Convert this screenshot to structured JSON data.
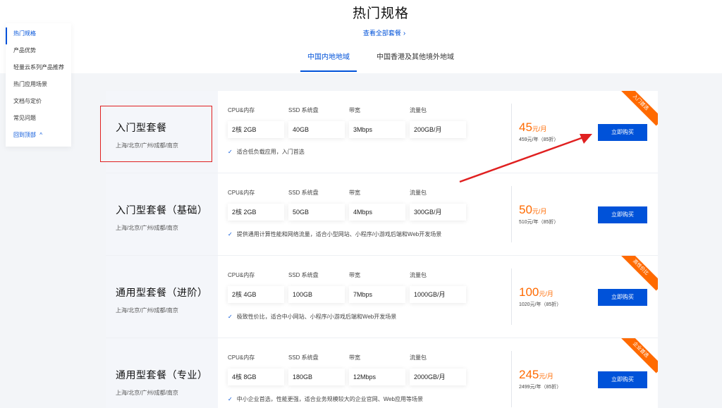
{
  "header": {
    "title": "热门规格",
    "view_all": "查看全部套餐",
    "tabs": [
      {
        "label": "中国内地地域",
        "active": true
      },
      {
        "label": "中国香港及其他境外地域",
        "active": false
      }
    ]
  },
  "sidebar": {
    "items": [
      {
        "label": "热门规格",
        "active": true
      },
      {
        "label": "产品优势"
      },
      {
        "label": "轻量云系列产品推荐"
      },
      {
        "label": "热门应用场景"
      },
      {
        "label": "文档与定价"
      },
      {
        "label": "常见问题"
      },
      {
        "label": "回到顶部"
      }
    ]
  },
  "spec_labels": [
    "CPU&内存",
    "SSD 系统盘",
    "带宽",
    "流量包"
  ],
  "buy_label": "立即购买",
  "plans": [
    {
      "name": "入门型套餐",
      "regions": "上海/北京/广州/成都/南京",
      "specs": [
        "2核 2GB",
        "40GB",
        "3Mbps",
        "200GB/月"
      ],
      "desc": "适合低负载应用，入门首选",
      "price": "45",
      "price_unit": "元/月",
      "yearly": "459元/年（85折）",
      "ribbon": "入门首选"
    },
    {
      "name": "入门型套餐（基础）",
      "regions": "上海/北京/广州/成都/南京",
      "specs": [
        "2核 2GB",
        "50GB",
        "4Mbps",
        "300GB/月"
      ],
      "desc": "提供通用计算性能和网络流量，适合小型网站、小程序/小游戏后端和Web开发场景",
      "price": "50",
      "price_unit": "元/月",
      "yearly": "510元/年（85折）",
      "ribbon": ""
    },
    {
      "name": "通用型套餐（进阶）",
      "regions": "上海/北京/广州/成都/南京",
      "specs": [
        "2核 4GB",
        "100GB",
        "7Mbps",
        "1000GB/月"
      ],
      "desc": "极致性价比，适合中小网站、小程序/小游戏后端和Web开发场景",
      "price": "100",
      "price_unit": "元/月",
      "yearly": "1020元/年（85折）",
      "ribbon": "高性价比"
    },
    {
      "name": "通用型套餐（专业）",
      "regions": "上海/北京/广州/成都/南京",
      "specs": [
        "4核 8GB",
        "180GB",
        "12Mbps",
        "2000GB/月"
      ],
      "desc": "中小企业首选，性能更强，适合业务规模较大的企业官网、Web应用等场景",
      "price": "245",
      "price_unit": "元/月",
      "yearly": "2499元/年（85折）",
      "ribbon": "企业首选"
    }
  ],
  "colors": {
    "accent": "#0052d9",
    "price": "#ff6a00",
    "annotation": "#e02020"
  }
}
